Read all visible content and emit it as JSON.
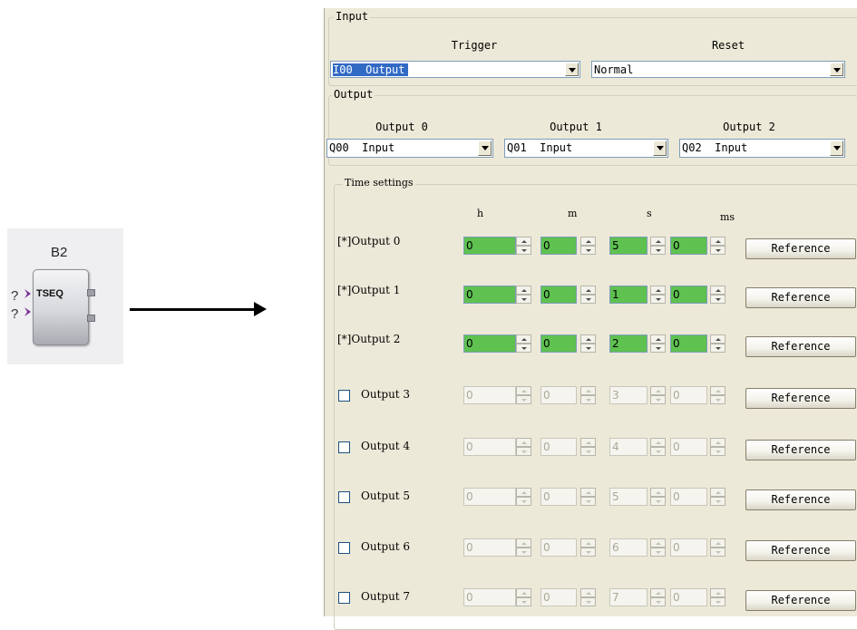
{
  "block": {
    "name": "B2",
    "label": "TSEQ",
    "input1": "?",
    "input2": "?"
  },
  "dialog": {
    "input_group": {
      "title": "Input",
      "trigger_label": "Trigger",
      "trigger_value": "I00  Output",
      "reset_label": "Reset",
      "reset_value": "Normal"
    },
    "output_group": {
      "title": "Output",
      "outputs": [
        {
          "label": "Output 0",
          "value": "Q00  Input"
        },
        {
          "label": "Output 1",
          "value": "Q01  Input"
        },
        {
          "label": "Output 2",
          "value": "Q02  Input"
        }
      ]
    },
    "time_settings": {
      "title": "Time settings",
      "columns": {
        "h": "h",
        "m": "m",
        "s": "s",
        "ms": "ms"
      },
      "reference_label": "Reference",
      "rows": [
        {
          "label": "[*]Output 0",
          "enabled": true,
          "h": "0",
          "m": "0",
          "s": "5",
          "ms": "0"
        },
        {
          "label": "[*]Output 1",
          "enabled": true,
          "h": "0",
          "m": "0",
          "s": "1",
          "ms": "0"
        },
        {
          "label": "[*]Output 2",
          "enabled": true,
          "h": "0",
          "m": "0",
          "s": "2",
          "ms": "0"
        },
        {
          "label": "Output 3",
          "enabled": false,
          "h": "0",
          "m": "0",
          "s": "3",
          "ms": "0"
        },
        {
          "label": "Output 4",
          "enabled": false,
          "h": "0",
          "m": "0",
          "s": "4",
          "ms": "0"
        },
        {
          "label": "Output 5",
          "enabled": false,
          "h": "0",
          "m": "0",
          "s": "5",
          "ms": "0"
        },
        {
          "label": "Output 6",
          "enabled": false,
          "h": "0",
          "m": "0",
          "s": "6",
          "ms": "0"
        },
        {
          "label": "Output 7",
          "enabled": false,
          "h": "0",
          "m": "0",
          "s": "7",
          "ms": "0"
        }
      ]
    }
  },
  "colors": {
    "enabled_field": "#5ec150",
    "panel_bg": "#ece9d8",
    "selection": "#316ac5"
  }
}
